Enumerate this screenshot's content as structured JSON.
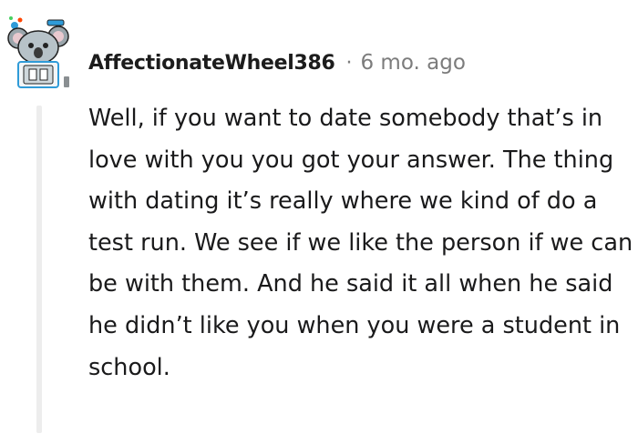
{
  "comment": {
    "author": "AffectionateWheel386",
    "separator": "·",
    "timestamp": "6 mo. ago",
    "avatar_icon": "snoo-koala-avatar",
    "body": "Well, if you want to date somebody that’s in love with you you got your answer. The thing with dating it’s really where we kind of do a test run. We see if we like the person if we can be with them. And he said it all when he said he didn’t like you when you were a student in school."
  },
  "colors": {
    "username": "#1c1c1c",
    "meta_gray": "#7c7c7c",
    "thread_line": "#ededed",
    "avatar_bg": "#cfd8dc",
    "avatar_accent": "#2f9bd8"
  }
}
